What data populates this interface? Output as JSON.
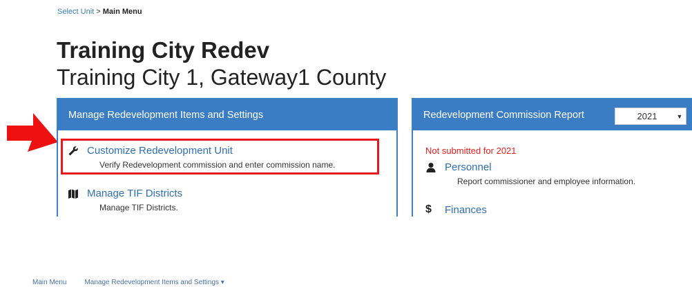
{
  "breadcrumb": {
    "link": "Select Unit",
    "separator": " > ",
    "current": "Main Menu"
  },
  "unit": {
    "title": "Training City Redev",
    "subtitle": "Training City 1, Gateway1 County"
  },
  "left_panel": {
    "heading": "Manage Redevelopment Items and Settings",
    "items": [
      {
        "label": "Customize Redevelopment Unit",
        "description": "Verify Redevelopment commission and enter commission name.",
        "icon": "wrench-icon"
      },
      {
        "label": "Manage TIF Districts",
        "description": "Manage TIF Districts.",
        "icon": "map-icon"
      }
    ]
  },
  "right_panel": {
    "heading": "Redevelopment Commission Report",
    "year": "2021",
    "status": "Not submitted for 2021",
    "items": [
      {
        "label": "Personnel",
        "description": "Report commissioner and employee information.",
        "icon": "user-icon"
      },
      {
        "label": "Finances",
        "description": "",
        "icon": "dollar-icon"
      }
    ]
  },
  "bottom_nav": {
    "main_menu": "Main Menu",
    "manage_menu": "Manage Redevelopment Items and Settings ▾"
  },
  "colors": {
    "panel_blue": "#3b7dc4",
    "link_blue": "#2f6fb3",
    "alert_red": "#e8181e"
  }
}
